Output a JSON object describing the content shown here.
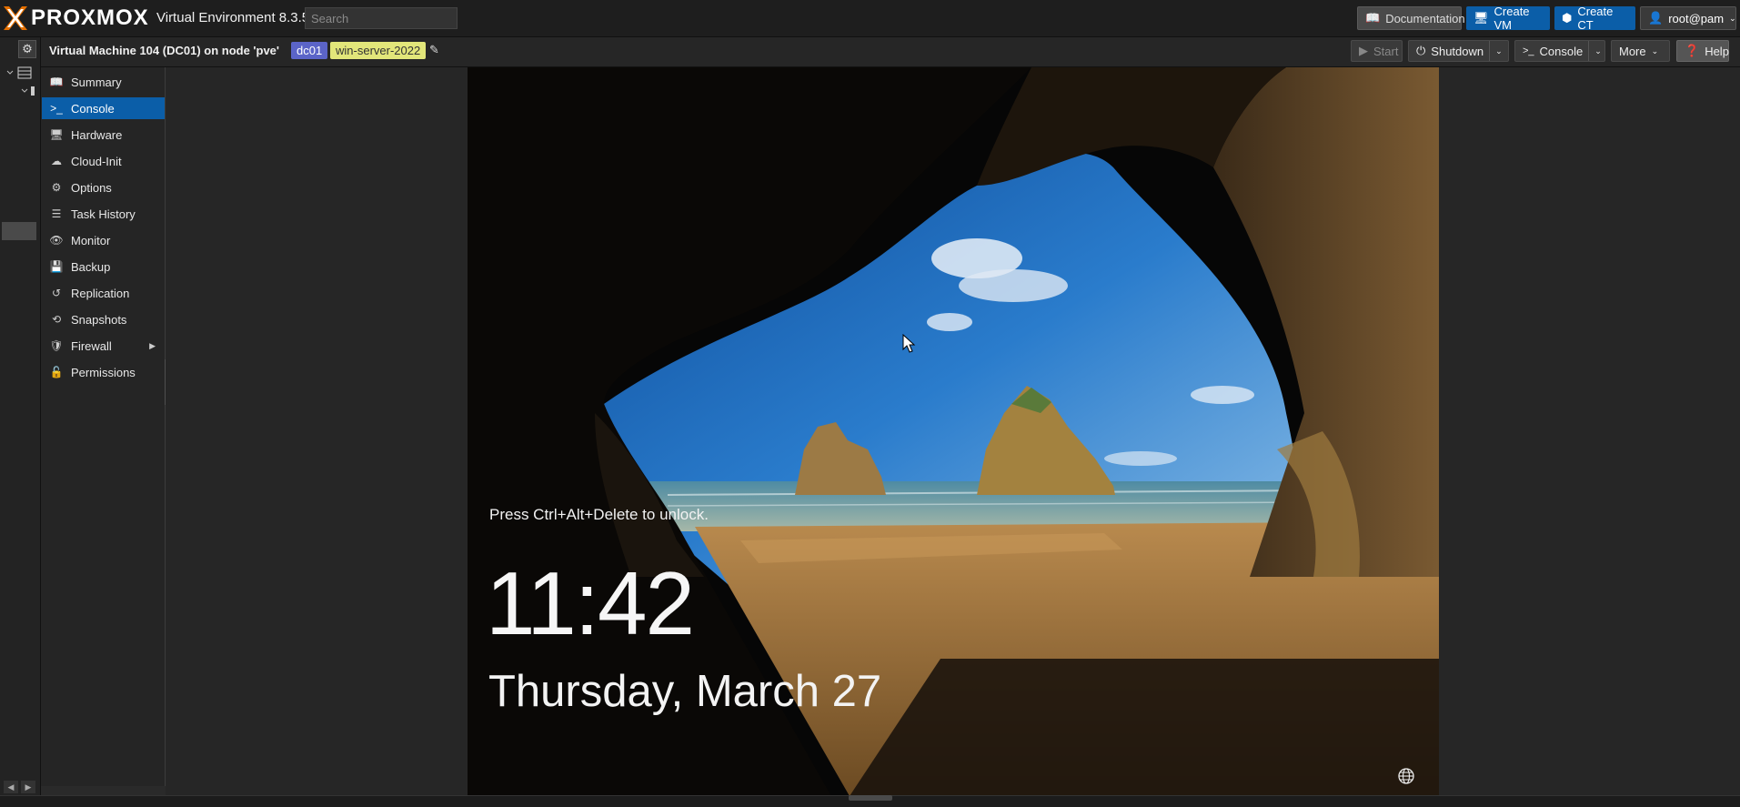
{
  "header": {
    "brand": "PROXMOX",
    "product": "Virtual Environment 8.3.5",
    "search_placeholder": "Search",
    "buttons": {
      "documentation": "Documentation",
      "create_vm": "Create VM",
      "create_ct": "Create CT",
      "user": "root@pam"
    }
  },
  "vm_header": {
    "title": "Virtual Machine 104 (DC01) on node 'pve'",
    "tags": [
      "dc01",
      "win-server-2022"
    ],
    "actions": {
      "start": "Start",
      "shutdown": "Shutdown",
      "console": "Console",
      "more": "More",
      "help": "Help"
    }
  },
  "nav": {
    "items": [
      {
        "label": "Summary",
        "icon": "book-icon"
      },
      {
        "label": "Console",
        "icon": "terminal-icon",
        "active": true
      },
      {
        "label": "Hardware",
        "icon": "monitor-icon"
      },
      {
        "label": "Cloud-Init",
        "icon": "cloud-icon"
      },
      {
        "label": "Options",
        "icon": "gear-icon"
      },
      {
        "label": "Task History",
        "icon": "list-icon"
      },
      {
        "label": "Monitor",
        "icon": "eye-icon"
      },
      {
        "label": "Backup",
        "icon": "floppy-icon"
      },
      {
        "label": "Replication",
        "icon": "retweet-icon"
      },
      {
        "label": "Snapshots",
        "icon": "history-icon"
      },
      {
        "label": "Firewall",
        "icon": "shield-icon",
        "has_submenu": true
      },
      {
        "label": "Permissions",
        "icon": "unlock-icon"
      }
    ]
  },
  "console": {
    "unlock_text": "Press Ctrl+Alt+Delete to unlock.",
    "time": "11:42",
    "date": "Thursday, March 27"
  },
  "colors": {
    "accent": "#0b5ea8",
    "brand_orange": "#e57000",
    "tag_dc01": "#5b64c8",
    "tag_os": "#e2e67a"
  }
}
